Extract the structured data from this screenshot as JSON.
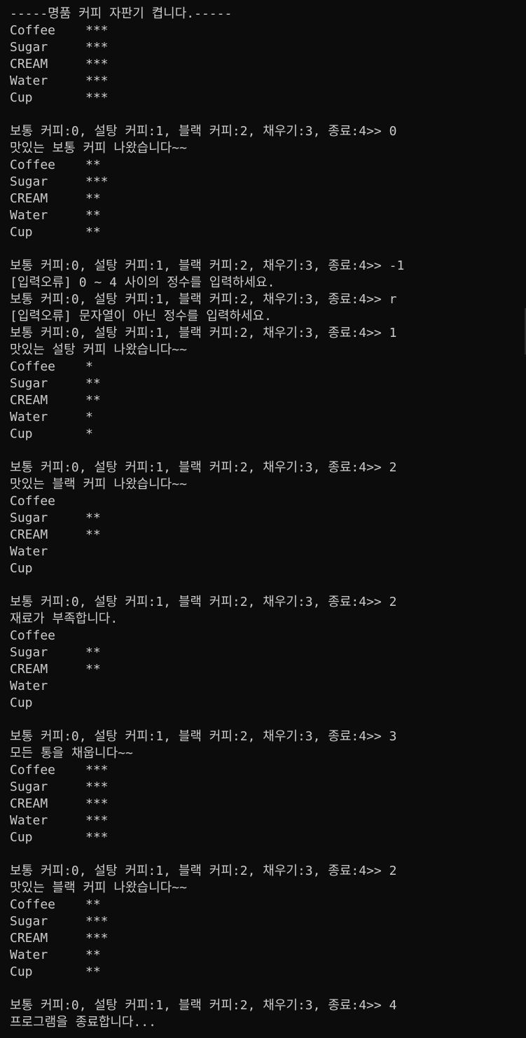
{
  "window": {
    "background": "#0c0c0c",
    "foreground": "#cccccc"
  },
  "blocks": [
    {
      "type": "text",
      "value": "-----명품 커피 자판기 켭니다.-----"
    },
    {
      "type": "status",
      "rows": [
        {
          "name": "Coffee",
          "level": "***"
        },
        {
          "name": "Sugar",
          "level": "***"
        },
        {
          "name": "CREAM",
          "level": "***"
        },
        {
          "name": "Water",
          "level": "***"
        },
        {
          "name": "Cup",
          "level": "***"
        }
      ]
    },
    {
      "type": "text",
      "value": ""
    },
    {
      "type": "text",
      "value": "보통 커피:0, 설탕 커피:1, 블랙 커피:2, 채우기:3, 종료:4>> 0"
    },
    {
      "type": "text",
      "value": "맛있는 보통 커피 나왔습니다~~"
    },
    {
      "type": "status",
      "rows": [
        {
          "name": "Coffee",
          "level": "**"
        },
        {
          "name": "Sugar",
          "level": "***"
        },
        {
          "name": "CREAM",
          "level": "**"
        },
        {
          "name": "Water",
          "level": "**"
        },
        {
          "name": "Cup",
          "level": "**"
        }
      ]
    },
    {
      "type": "text",
      "value": ""
    },
    {
      "type": "text",
      "value": "보통 커피:0, 설탕 커피:1, 블랙 커피:2, 채우기:3, 종료:4>> -1"
    },
    {
      "type": "text",
      "value": "[입력오류] 0 ~ 4 사이의 정수를 입력하세요."
    },
    {
      "type": "text",
      "value": "보통 커피:0, 설탕 커피:1, 블랙 커피:2, 채우기:3, 종료:4>> r"
    },
    {
      "type": "text",
      "value": "[입력오류] 문자열이 아닌 정수를 입력하세요."
    },
    {
      "type": "text",
      "value": "보통 커피:0, 설탕 커피:1, 블랙 커피:2, 채우기:3, 종료:4>> 1"
    },
    {
      "type": "text",
      "value": "맛있는 설탕 커피 나왔습니다~~"
    },
    {
      "type": "status",
      "rows": [
        {
          "name": "Coffee",
          "level": "*"
        },
        {
          "name": "Sugar",
          "level": "**"
        },
        {
          "name": "CREAM",
          "level": "**"
        },
        {
          "name": "Water",
          "level": "*"
        },
        {
          "name": "Cup",
          "level": "*"
        }
      ]
    },
    {
      "type": "text",
      "value": ""
    },
    {
      "type": "text",
      "value": "보통 커피:0, 설탕 커피:1, 블랙 커피:2, 채우기:3, 종료:4>> 2"
    },
    {
      "type": "text",
      "value": "맛있는 블랙 커피 나왔습니다~~"
    },
    {
      "type": "status",
      "rows": [
        {
          "name": "Coffee",
          "level": ""
        },
        {
          "name": "Sugar",
          "level": "**"
        },
        {
          "name": "CREAM",
          "level": "**"
        },
        {
          "name": "Water",
          "level": ""
        },
        {
          "name": "Cup",
          "level": ""
        }
      ]
    },
    {
      "type": "text",
      "value": ""
    },
    {
      "type": "text",
      "value": "보통 커피:0, 설탕 커피:1, 블랙 커피:2, 채우기:3, 종료:4>> 2"
    },
    {
      "type": "text",
      "value": "재료가 부족합니다."
    },
    {
      "type": "status",
      "rows": [
        {
          "name": "Coffee",
          "level": ""
        },
        {
          "name": "Sugar",
          "level": "**"
        },
        {
          "name": "CREAM",
          "level": "**"
        },
        {
          "name": "Water",
          "level": ""
        },
        {
          "name": "Cup",
          "level": ""
        }
      ]
    },
    {
      "type": "text",
      "value": ""
    },
    {
      "type": "text",
      "value": "보통 커피:0, 설탕 커피:1, 블랙 커피:2, 채우기:3, 종료:4>> 3"
    },
    {
      "type": "text",
      "value": "모든 통을 채웁니다~~"
    },
    {
      "type": "status",
      "rows": [
        {
          "name": "Coffee",
          "level": "***"
        },
        {
          "name": "Sugar",
          "level": "***"
        },
        {
          "name": "CREAM",
          "level": "***"
        },
        {
          "name": "Water",
          "level": "***"
        },
        {
          "name": "Cup",
          "level": "***"
        }
      ]
    },
    {
      "type": "text",
      "value": ""
    },
    {
      "type": "text",
      "value": "보통 커피:0, 설탕 커피:1, 블랙 커피:2, 채우기:3, 종료:4>> 2"
    },
    {
      "type": "text",
      "value": "맛있는 블랙 커피 나왔습니다~~"
    },
    {
      "type": "status",
      "rows": [
        {
          "name": "Coffee",
          "level": "**"
        },
        {
          "name": "Sugar",
          "level": "***"
        },
        {
          "name": "CREAM",
          "level": "***"
        },
        {
          "name": "Water",
          "level": "**"
        },
        {
          "name": "Cup",
          "level": "**"
        }
      ]
    },
    {
      "type": "text",
      "value": ""
    },
    {
      "type": "text",
      "value": "보통 커피:0, 설탕 커피:1, 블랙 커피:2, 채우기:3, 종료:4>> 4"
    },
    {
      "type": "text",
      "value": "프로그램을 종료합니다..."
    }
  ]
}
